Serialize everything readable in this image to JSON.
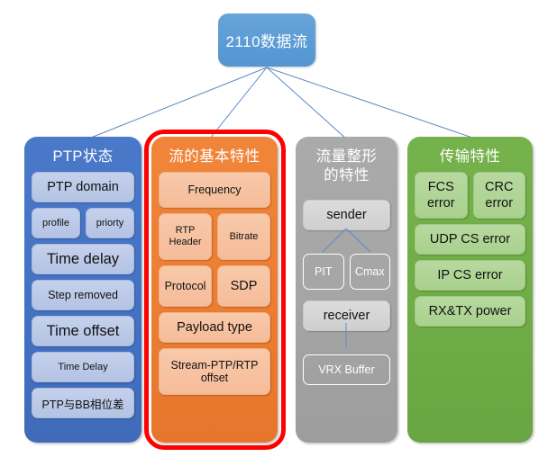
{
  "diagram": {
    "root": {
      "label": "2110数据流",
      "color": "#5b9bd5"
    },
    "columns": [
      {
        "id": "ptp",
        "title": "PTP状态",
        "color": "#4472c4",
        "item_color": "#b4c3e4",
        "rows": [
          {
            "items": [
              {
                "label": "PTP domain"
              }
            ]
          },
          {
            "items": [
              {
                "label": "profile"
              },
              {
                "label": "priorty"
              }
            ]
          },
          {
            "items": [
              {
                "label": "Time delay"
              }
            ]
          },
          {
            "items": [
              {
                "label": "Step removed"
              }
            ]
          },
          {
            "items": [
              {
                "label": "Time offset"
              }
            ]
          },
          {
            "items": [
              {
                "label": "Time Delay"
              }
            ]
          },
          {
            "items": [
              {
                "label": "PTP与BB相位差"
              }
            ]
          }
        ]
      },
      {
        "id": "stream",
        "title": "流的基本特性",
        "color": "#ed7d31",
        "item_color": "#f5bc99",
        "highlighted": true,
        "highlight_color": "#ff0000",
        "rows": [
          {
            "items": [
              {
                "label": "Frequency"
              }
            ]
          },
          {
            "items": [
              {
                "label": "RTP\nHeader"
              },
              {
                "label": "Bitrate"
              }
            ]
          },
          {
            "items": [
              {
                "label": "Protocol"
              },
              {
                "label": "SDP"
              }
            ]
          },
          {
            "items": [
              {
                "label": "Payload type"
              }
            ]
          },
          {
            "items": [
              {
                "label": "Stream-PTP/RTP offset"
              }
            ]
          }
        ]
      },
      {
        "id": "shaping",
        "title": "流量整形\n的特性",
        "color": "#a5a5a5",
        "item_color": "#cfcfcf",
        "rows": [
          {
            "items": [
              {
                "label": "sender"
              }
            ]
          },
          {
            "items": [
              {
                "label": "PIT"
              },
              {
                "label": "Cmax"
              }
            ]
          },
          {
            "items": [
              {
                "label": "receiver"
              }
            ]
          },
          {
            "items": [
              {
                "label": "VRX Buffer"
              }
            ]
          }
        ]
      },
      {
        "id": "transport",
        "title": "传输特性",
        "color": "#70ad47",
        "item_color": "#a9d18e",
        "rows": [
          {
            "items": [
              {
                "label": "FCS\nerror"
              },
              {
                "label": "CRC\nerror"
              }
            ]
          },
          {
            "items": [
              {
                "label": "UDP CS error"
              }
            ]
          },
          {
            "items": [
              {
                "label": "IP CS error"
              }
            ]
          },
          {
            "items": [
              {
                "label": "RX&TX power"
              }
            ]
          }
        ]
      }
    ],
    "connector_color": "#5b8ac6"
  },
  "labels": {
    "root_label": "2110数据流",
    "col1_title": "PTP状态",
    "col1_item1": "PTP domain",
    "col1_item2a": "profile",
    "col1_item2b": "priorty",
    "col1_item3": "Time delay",
    "col1_item4": "Step removed",
    "col1_item5": "Time offset",
    "col1_item6": "Time Delay",
    "col1_item7": "PTP与BB相位差",
    "col2_title": "流的基本特性",
    "col2_item1": "Frequency",
    "col2_item2a_line1": "RTP",
    "col2_item2a_line2": "Header",
    "col2_item2b": "Bitrate",
    "col2_item3a": "Protocol",
    "col2_item3b": "SDP",
    "col2_item4": "Payload type",
    "col2_item5": "Stream-PTP/RTP offset",
    "col3_title_line1": "流量整形",
    "col3_title_line2": "的特性",
    "col3_item1": "sender",
    "col3_item2a": "PIT",
    "col3_item2b": "Cmax",
    "col3_item3": "receiver",
    "col3_item4": "VRX Buffer",
    "col4_title": "传输特性",
    "col4_item1a_line1": "FCS",
    "col4_item1a_line2": "error",
    "col4_item1b_line1": "CRC",
    "col4_item1b_line2": "error",
    "col4_item2": "UDP CS error",
    "col4_item3": "IP CS error",
    "col4_item4": "RX&TX power"
  }
}
